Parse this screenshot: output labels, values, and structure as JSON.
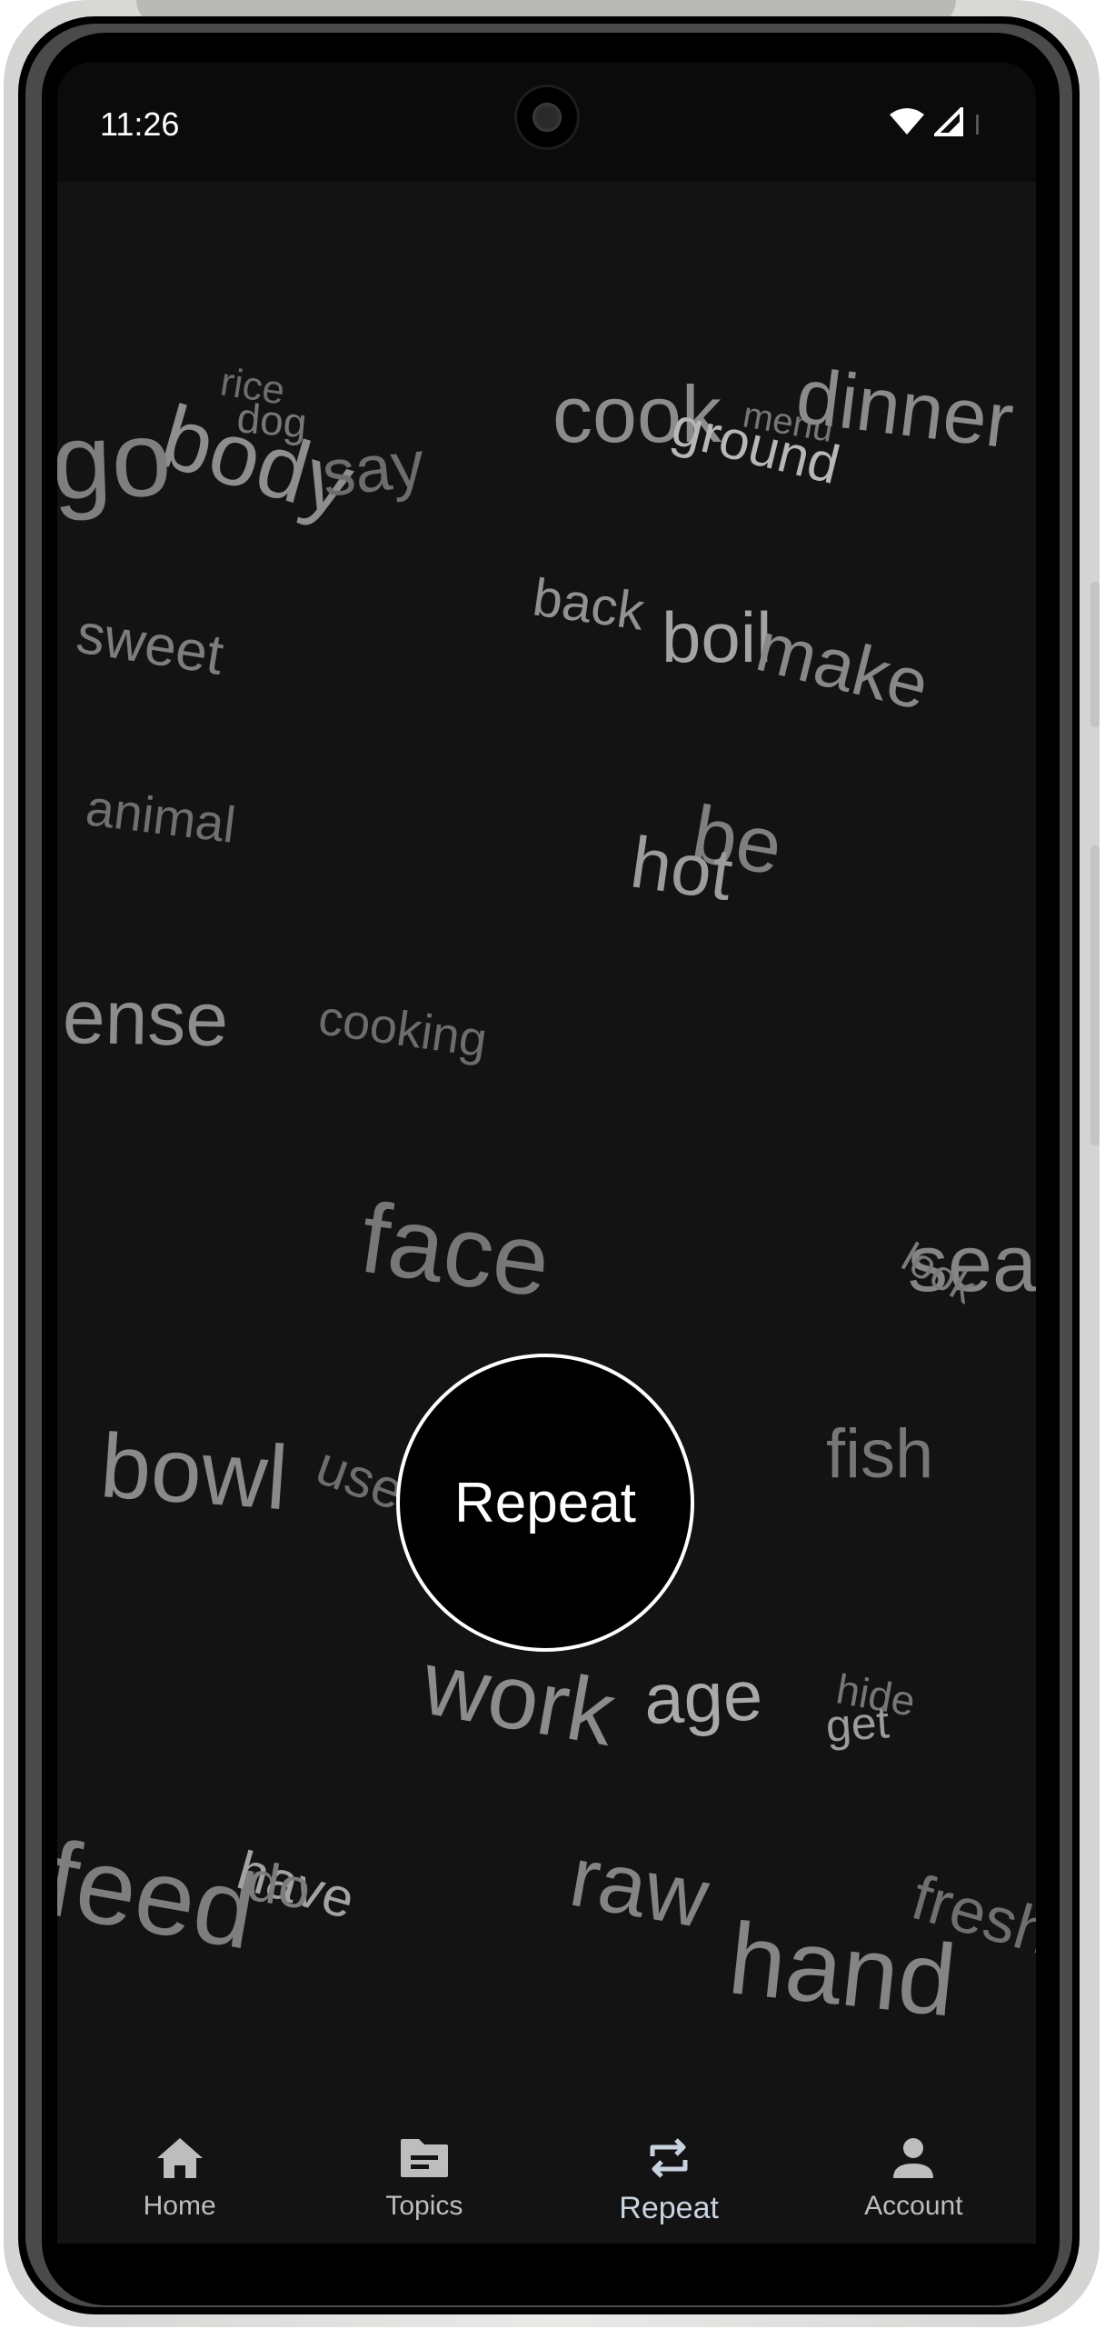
{
  "status_bar": {
    "time": "11:26",
    "icons": [
      "wifi-icon",
      "signal-icon",
      "battery-icon"
    ]
  },
  "words": [
    {
      "text": "rice"
    },
    {
      "text": "dog"
    },
    {
      "text": "body"
    },
    {
      "text": "go"
    },
    {
      "text": "say"
    },
    {
      "text": "cook"
    },
    {
      "text": "ground"
    },
    {
      "text": "menu"
    },
    {
      "text": "dinner"
    },
    {
      "text": "sweet"
    },
    {
      "text": "back"
    },
    {
      "text": "boil"
    },
    {
      "text": "make"
    },
    {
      "text": "animal"
    },
    {
      "text": "be"
    },
    {
      "text": "hot"
    },
    {
      "text": "ense"
    },
    {
      "text": "cooking"
    },
    {
      "text": "face"
    },
    {
      "text": "sea"
    },
    {
      "text": "look"
    },
    {
      "text": "bowl"
    },
    {
      "text": "use"
    },
    {
      "text": "fish"
    },
    {
      "text": "work"
    },
    {
      "text": "age"
    },
    {
      "text": "hide"
    },
    {
      "text": "get"
    },
    {
      "text": "feed"
    },
    {
      "text": "have"
    },
    {
      "text": "do"
    },
    {
      "text": "raw"
    },
    {
      "text": "hand"
    },
    {
      "text": "fresh"
    }
  ],
  "repeat_button": {
    "label": "Repeat"
  },
  "bottom_nav": {
    "items": [
      {
        "label": "Home",
        "icon": "home-icon",
        "active": false
      },
      {
        "label": "Topics",
        "icon": "topics-icon",
        "active": false
      },
      {
        "label": "Repeat",
        "icon": "repeat-icon",
        "active": true
      },
      {
        "label": "Account",
        "icon": "account-icon",
        "active": false
      }
    ]
  },
  "colors": {
    "screen_background": "#131313",
    "status_bar_background": "#0b0b0b",
    "word_text": "#8a8a8a",
    "button_background": "#000000",
    "button_border": "#ffffff",
    "nav_label": "#bdbdbd",
    "nav_active": "#c9d3e0"
  }
}
